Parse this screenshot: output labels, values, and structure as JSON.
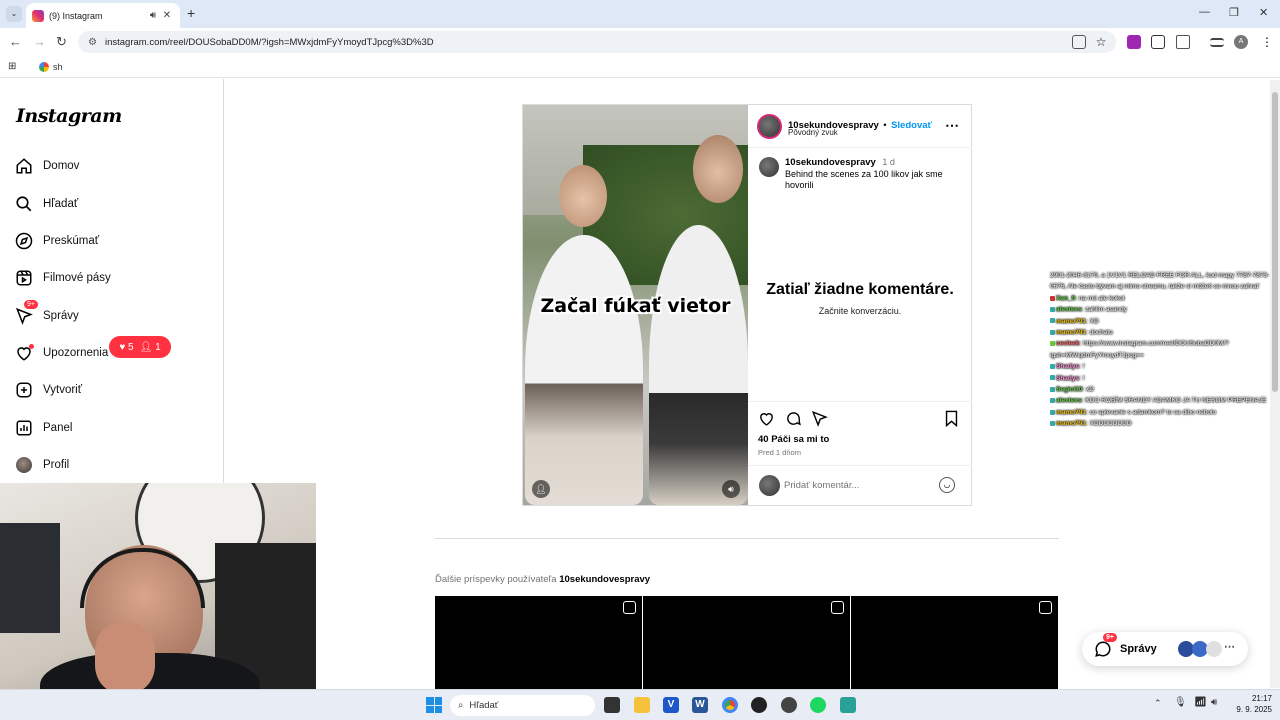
{
  "browser": {
    "tab_title": "(9) Instagram",
    "url": "instagram.com/reel/DOUSobaDD0M/?igsh=MWxjdmFyYmoydTJpcg%3D%3D",
    "bookmark": "sh"
  },
  "sidebar": {
    "logo": "Instagram",
    "items": [
      {
        "label": "Domov",
        "icon": "home-icon"
      },
      {
        "label": "Hľadať",
        "icon": "search-icon"
      },
      {
        "label": "Preskúmať",
        "icon": "compass-icon"
      },
      {
        "label": "Filmové pásy",
        "icon": "reels-icon"
      },
      {
        "label": "Správy",
        "icon": "messenger-icon",
        "badge": "9+"
      },
      {
        "label": "Upozornenia",
        "icon": "heart-icon"
      },
      {
        "label": "Vytvoriť",
        "icon": "plus-square-icon"
      },
      {
        "label": "Panel",
        "icon": "dashboard-icon"
      },
      {
        "label": "Profil",
        "icon": "avatar"
      }
    ],
    "notifications_popup": {
      "likes": "5",
      "follows": "1"
    }
  },
  "post": {
    "video_caption": "Začal fúkať vietor",
    "username": "10sekundovespravy",
    "follow_label": "Sledovať",
    "separator": "•",
    "audio": "Pôvodný zvuk",
    "caption_username": "10sekundovespravy",
    "caption_age": "1 d",
    "caption_text": "Behind the scenes za 100 likov jak sme hovorili",
    "no_comments": "Zatiaľ žiadne komentáre.",
    "start_conversation": "Začnite konverzáciu.",
    "likes": "40 Páči sa mi to",
    "posted": "Pred 1 dňom",
    "add_comment_placeholder": "Pridať komentár..."
  },
  "more_posts": {
    "prefix": "Ďalšie príspevky používateľa",
    "username": "10sekundovespravy"
  },
  "messages_float": {
    "label": "Správy",
    "badge": "9+"
  },
  "chat": [
    {
      "user": "",
      "text": "2901-2046-3170, a 1V1V1 RELOAD FREE FOR ALL, kod mapy 7787-7873-0676, Ale často bývam aj mimo streamu, takže si môžeš so mnou zahrať"
    },
    {
      "user": "Xan_9",
      "text": "na mú ale kokot"
    },
    {
      "user": "alextexs",
      "text": "zahlim asandy"
    },
    {
      "user": "mamo791",
      "text": "XD"
    },
    {
      "user": "mamo791",
      "text": "dochatu"
    },
    {
      "user": "cecleek",
      "text": "https://www.instagram.com/reel/DOUSobaDD0M/?igsh=MWxjdmFyYmoydTJpcg=="
    },
    {
      "user": "Shadys",
      "text": "!"
    },
    {
      "user": "Shadys",
      "text": "!"
    },
    {
      "user": "Segici10",
      "text": "xD"
    },
    {
      "user": "alextexs",
      "text": "KDO ROBÍM SRANDY ADAMKO JA TU NESOM PREPENAJE"
    },
    {
      "user": "mamo791",
      "text": "co spievanie s adamkom? to sa dibo nebolo"
    },
    {
      "user": "mamo791",
      "text": "XDDDDDDDD"
    }
  ],
  "taskbar": {
    "search": "Hľadať",
    "time": "21:17",
    "date": "9. 9. 2025"
  },
  "colors": {
    "accent": "#0095f6",
    "notification": "#ff3040",
    "tabstrip": "#dfe8f6"
  }
}
